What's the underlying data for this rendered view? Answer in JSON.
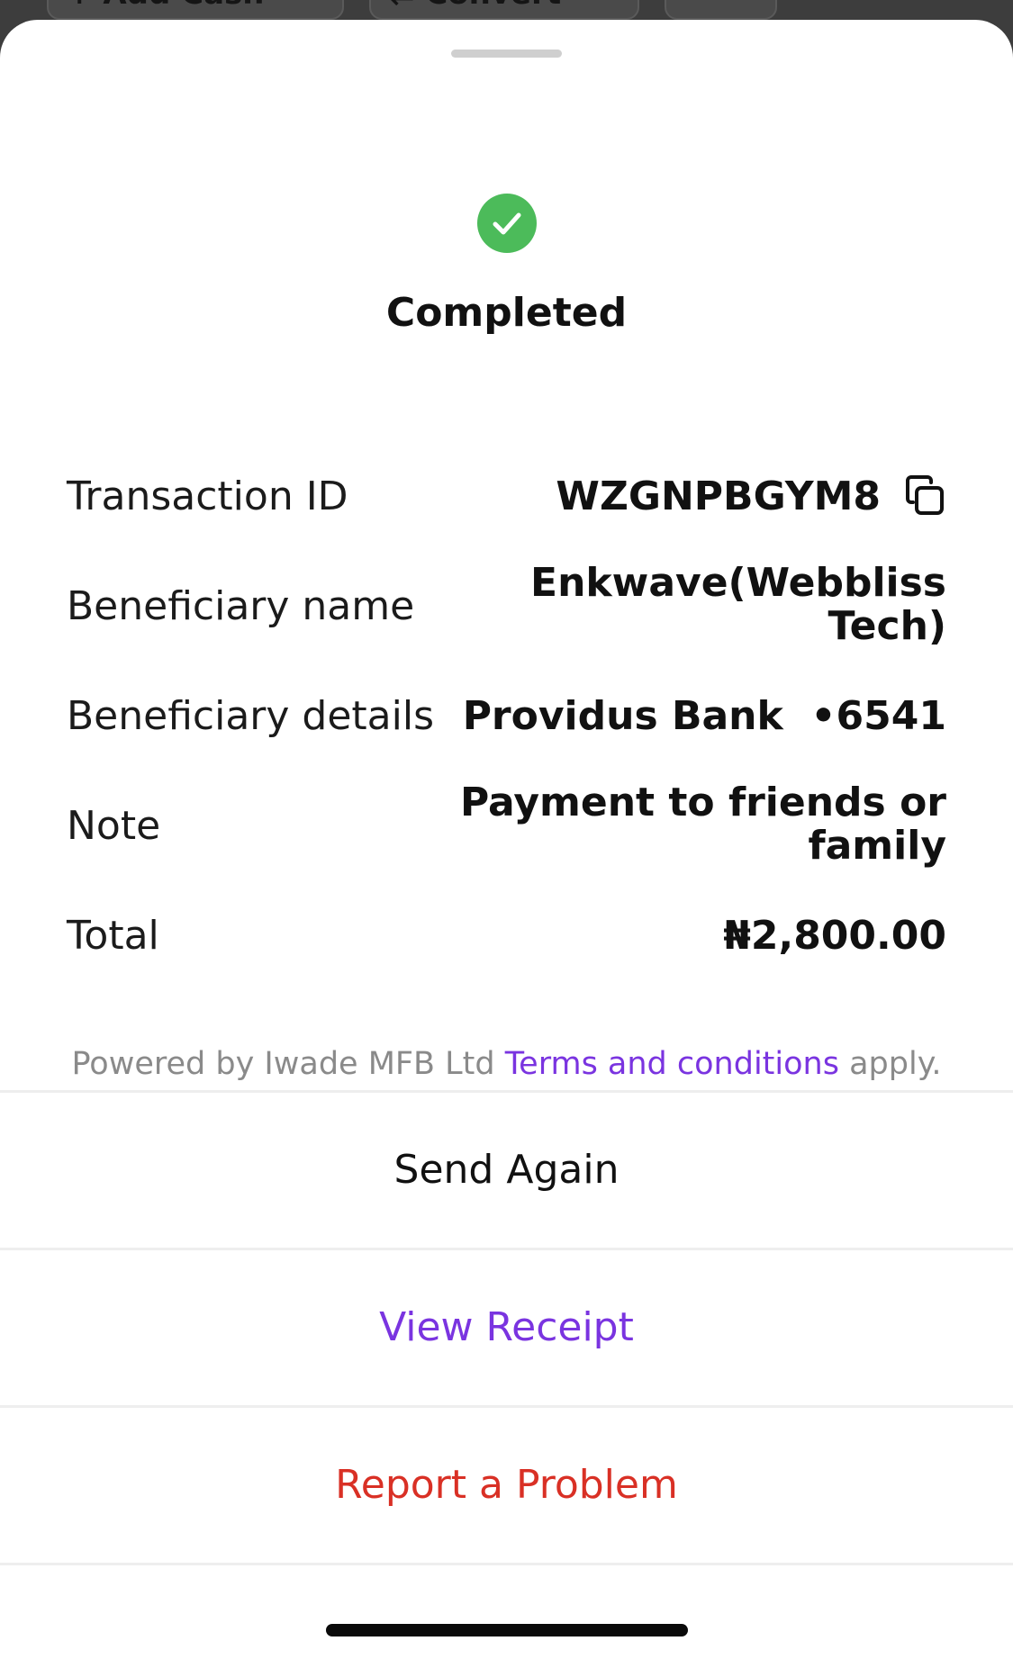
{
  "background_actions": {
    "add_cash_label": "+ Add Cash",
    "convert_label": "⇄ Convert"
  },
  "status": {
    "title": "Completed",
    "icon": "check-circle-icon",
    "color": "#4cbb5a"
  },
  "details": {
    "transaction_id_label": "Transaction ID",
    "transaction_id_value": "WZGNPBGYM8",
    "beneficiary_name_label": "Beneficiary name",
    "beneficiary_name_line1": "Enkwave(Webbliss",
    "beneficiary_name_line2": "Tech)",
    "beneficiary_details_label": "Beneficiary details",
    "beneficiary_details_value": "Providus Bank  •6541",
    "note_label": "Note",
    "note_line1": "Payment to friends or",
    "note_line2": "family",
    "total_label": "Total",
    "total_value": "₦2,800.00"
  },
  "footer": {
    "prefix": "Powered by Iwade MFB Ltd ",
    "link": "Terms and conditions",
    "suffix": " apply."
  },
  "actions": {
    "send_again": "Send Again",
    "view_receipt": "View Receipt",
    "report_problem": "Report a Problem"
  },
  "colors": {
    "accent": "#7a34e0",
    "danger": "#d93025",
    "success": "#4cbb5a"
  }
}
